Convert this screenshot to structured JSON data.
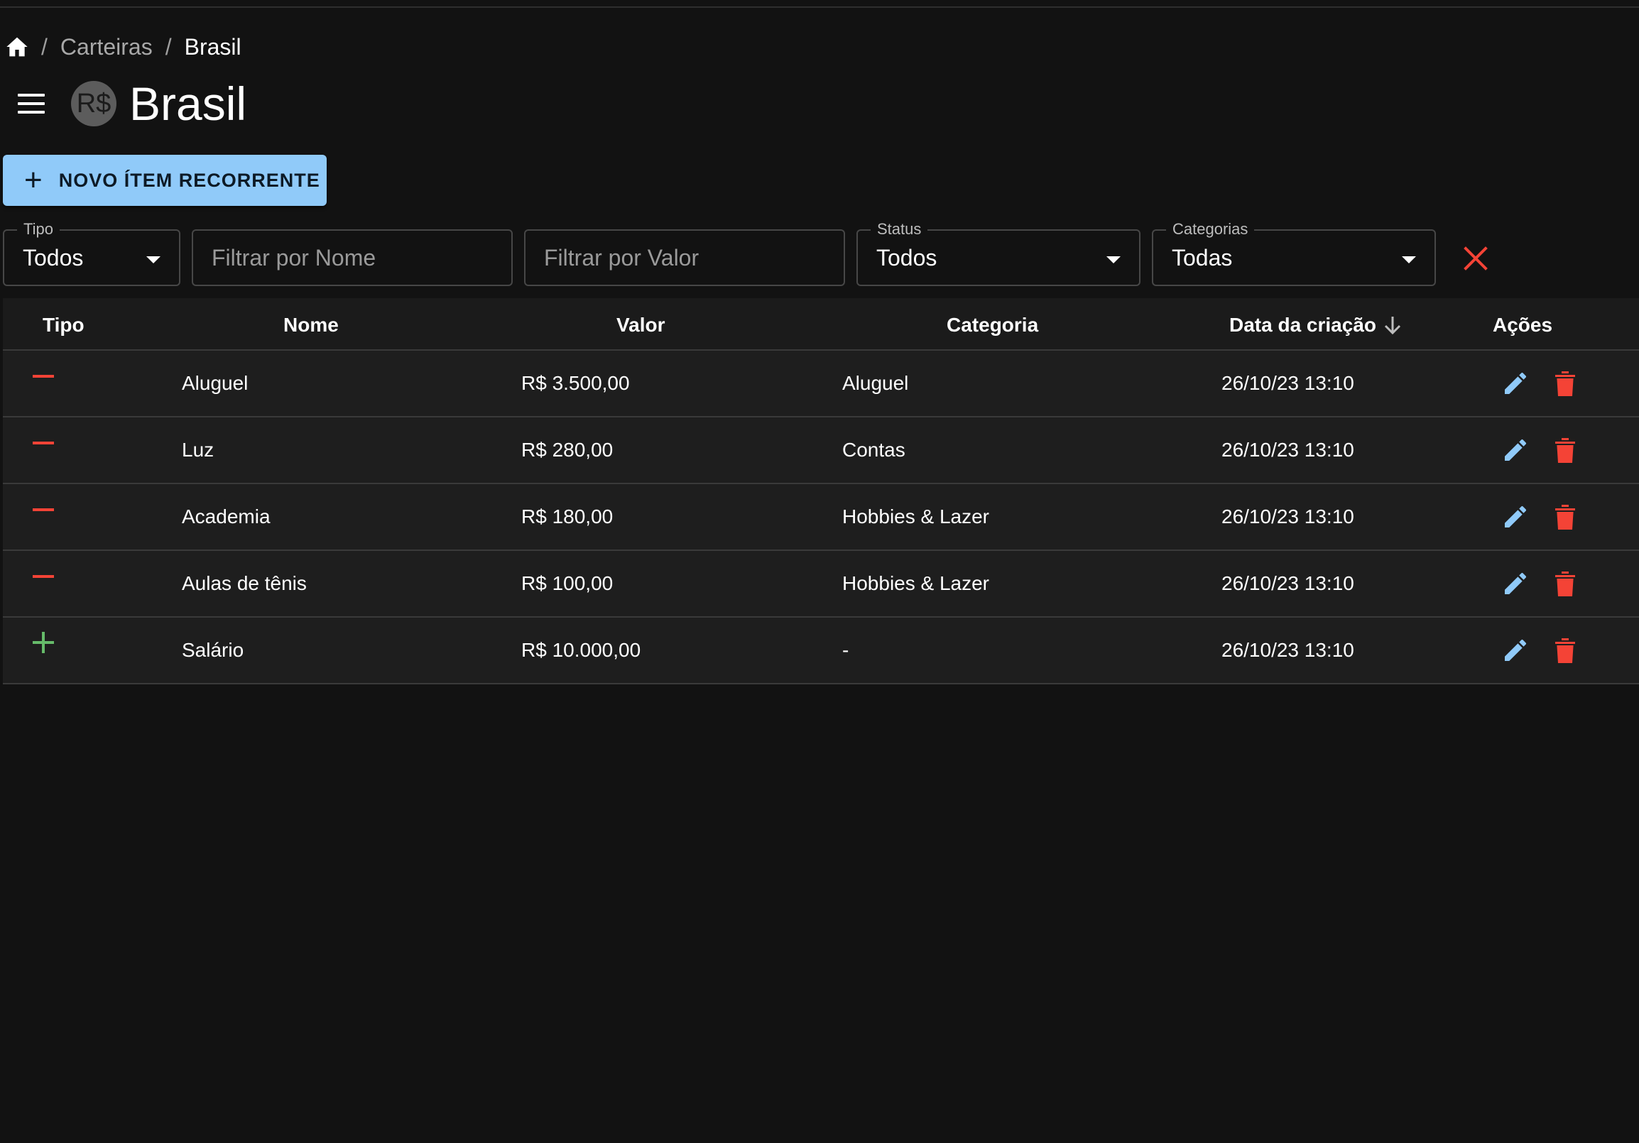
{
  "breadcrumb": {
    "items": [
      "Carteiras",
      "Brasil"
    ],
    "separator": "/"
  },
  "header": {
    "avatar_text": "R$",
    "title": "Brasil"
  },
  "toolbar": {
    "new_button_label": "NOVO ÍTEM RECORRENTE"
  },
  "filters": {
    "type": {
      "label": "Tipo",
      "value": "Todos"
    },
    "name": {
      "placeholder": "Filtrar por Nome"
    },
    "value": {
      "placeholder": "Filtrar por Valor"
    },
    "status": {
      "label": "Status",
      "value": "Todos"
    },
    "categories": {
      "label": "Categorias",
      "value": "Todas"
    }
  },
  "table": {
    "columns": [
      "Tipo",
      "Nome",
      "Valor",
      "Categoria",
      "Data da criação",
      "Ações"
    ],
    "rows": [
      {
        "type": "expense",
        "name": "Aluguel",
        "value": "R$ 3.500,00",
        "category": "Aluguel",
        "created": "26/10/23 13:10"
      },
      {
        "type": "expense",
        "name": "Luz",
        "value": "R$ 280,00",
        "category": "Contas",
        "created": "26/10/23 13:10"
      },
      {
        "type": "expense",
        "name": "Academia",
        "value": "R$ 180,00",
        "category": "Hobbies & Lazer",
        "created": "26/10/23 13:10"
      },
      {
        "type": "expense",
        "name": "Aulas de tênis",
        "value": "R$ 100,00",
        "category": "Hobbies & Lazer",
        "created": "26/10/23 13:10"
      },
      {
        "type": "income",
        "name": "Salário",
        "value": "R$ 10.000,00",
        "category": "-",
        "created": "26/10/23 13:10"
      }
    ]
  },
  "colors": {
    "background": "#121212",
    "primary": "#90caf9",
    "expense": "#f44336",
    "income": "#66bb6a",
    "delete": "#f44336"
  },
  "icons": [
    "home-icon",
    "menu-icon",
    "plus-icon",
    "chevron-down-icon",
    "close-icon",
    "arrow-down-icon",
    "edit-icon",
    "delete-icon"
  ]
}
